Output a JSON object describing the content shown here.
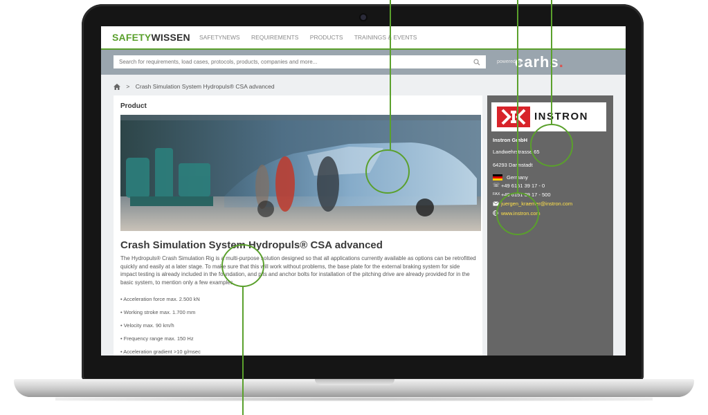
{
  "site": {
    "logo_part1": "SAFETY",
    "logo_part2": "WISSEN",
    "nav": [
      "SAFETYNEWS",
      "REQUIREMENTS",
      "PRODUCTS",
      "TRAININGS & EVENTS"
    ]
  },
  "search": {
    "placeholder": "Search for requirements, load cases, protocols, products, companies and more...",
    "powered_by": "powered by",
    "partner_logo": "carhs",
    "partner_logo_dot": "."
  },
  "breadcrumb": {
    "separator": ">",
    "current": "Crash Simulation System Hydropuls® CSA advanced"
  },
  "product": {
    "section_label": "Product",
    "title": "Crash Simulation System Hydropuls® CSA advanced",
    "description": "The Hydropuls® Crash Simulation Rig is a multi-purpose solution designed so that all applications currently available as options can be retrofitted quickly and easily at a later stage. To make sure that this will work without problems, the base plate for the external braking system for side impact testing is already included in the foundation, and pits and anchor bolts for installation of the pitching drive are already provided for in the basic system, to mention only a few examples.",
    "specs": [
      "• Acceleration force max. 2.500 kN",
      "• Working stroke max. 1.700 mm",
      "• Velocity max. 90 km/h",
      "• Frequency range max. 150 Hz",
      "• Acceleration gradient >10 g/msec"
    ]
  },
  "company": {
    "brand": "INSTRON",
    "name": "Instron GmbH",
    "street": "Landwehrstrasse 65",
    "city": "64293 Darmstadt",
    "country": "Germany",
    "phone": "+49 6151 39 17 - 0",
    "fax_label": "FAX",
    "fax": "+49 6151 39 17 - 500",
    "email": "juergen_kraemer@instron.com",
    "website": "www.instron.com"
  },
  "colors": {
    "accent_green": "#5aa02c",
    "link_yellow": "#ffe14a",
    "sidebar_gray": "#666666",
    "brand_red": "#d8232a"
  },
  "icons": [
    "home-icon",
    "search-icon",
    "phone-icon",
    "mail-icon",
    "globe-icon",
    "flag-germany-icon"
  ]
}
